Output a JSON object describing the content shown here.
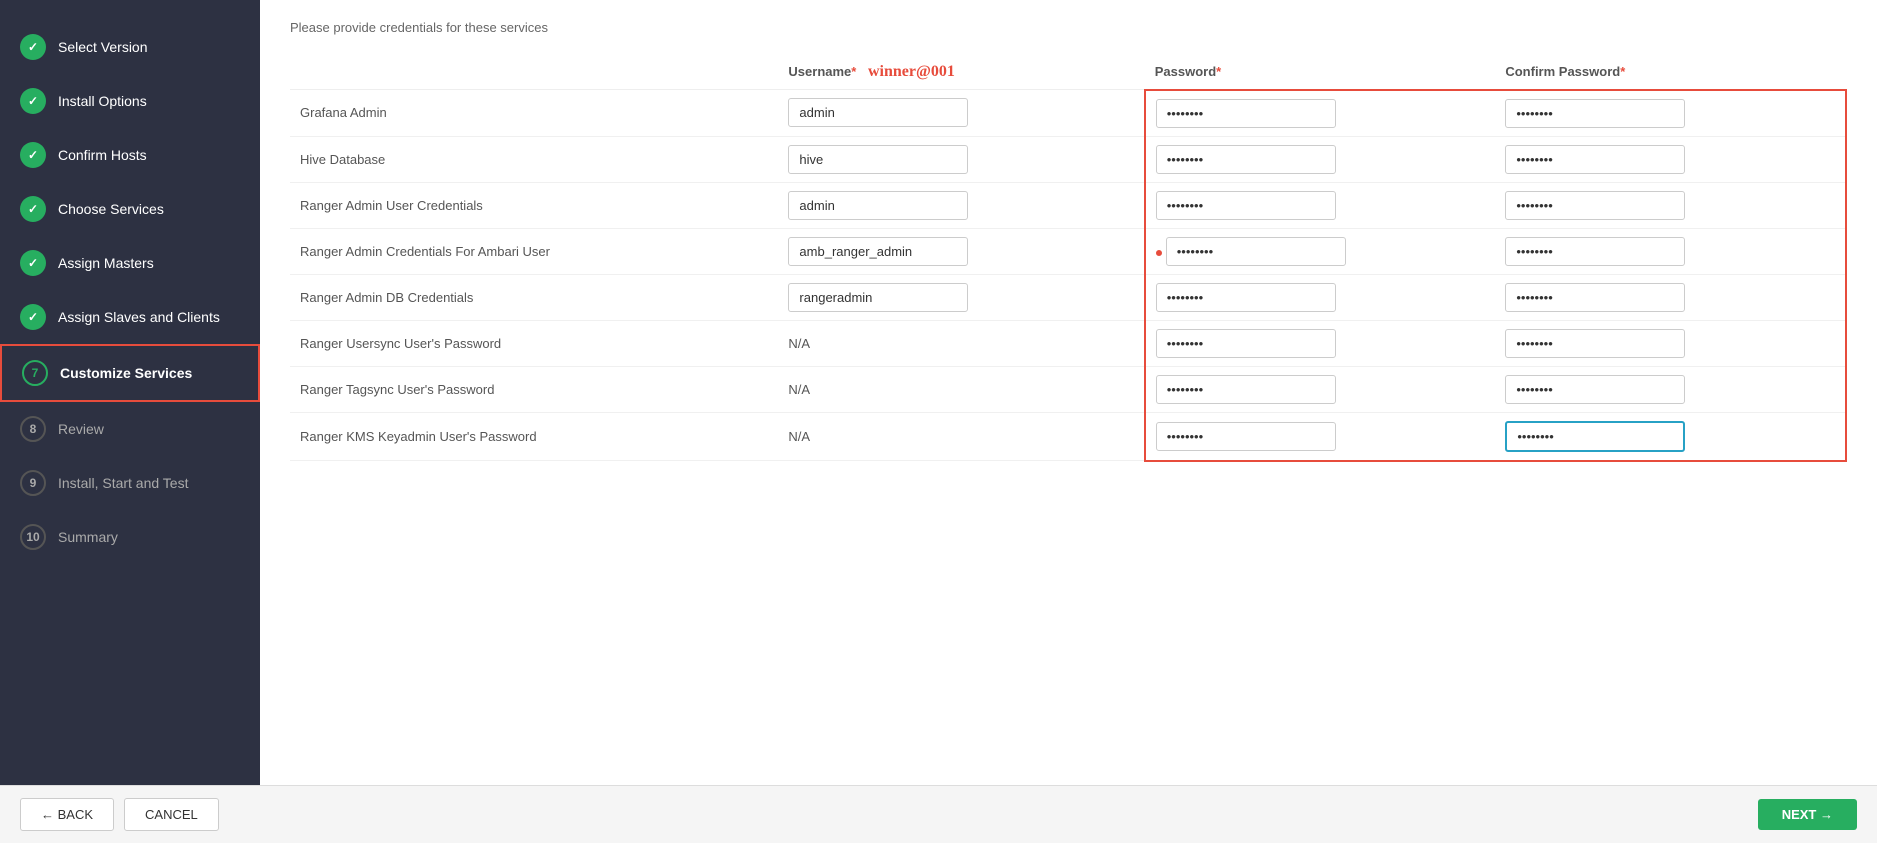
{
  "sidebar": {
    "items": [
      {
        "step": "✓",
        "label": "Select Version",
        "state": "completed"
      },
      {
        "step": "✓",
        "label": "Install Options",
        "state": "completed"
      },
      {
        "step": "✓",
        "label": "Confirm Hosts",
        "state": "completed"
      },
      {
        "step": "✓",
        "label": "Choose Services",
        "state": "completed"
      },
      {
        "step": "✓",
        "label": "Assign Masters",
        "state": "completed"
      },
      {
        "step": "✓",
        "label": "Assign Slaves and Clients",
        "state": "completed"
      },
      {
        "step": "7",
        "label": "Customize Services",
        "state": "active"
      },
      {
        "step": "8",
        "label": "Review",
        "state": "inactive"
      },
      {
        "step": "9",
        "label": "Install, Start and Test",
        "state": "inactive"
      },
      {
        "step": "10",
        "label": "Summary",
        "state": "inactive"
      }
    ]
  },
  "header": {
    "subtitle": "Please provide credentials for these services"
  },
  "columns": {
    "label": "",
    "username": "Username",
    "password": "Password",
    "confirm_password": "Confirm Password",
    "winner_label": "winner@001"
  },
  "rows": [
    {
      "service": "Grafana Admin",
      "username": "admin",
      "password": "••••••••••",
      "confirm_password": "••••••••••",
      "has_red_dot": false
    },
    {
      "service": "Hive Database",
      "username": "hive",
      "password": "••••••••••",
      "confirm_password": "••••••••••",
      "has_red_dot": false
    },
    {
      "service": "Ranger Admin User Credentials",
      "username": "admin",
      "password": "••••••••••",
      "confirm_password": "••••••••••",
      "has_red_dot": false
    },
    {
      "service": "Ranger Admin Credentials For Ambari User",
      "username": "amb_ranger_admin",
      "password": "••••••••••",
      "confirm_password": "••••••••••",
      "has_red_dot": true
    },
    {
      "service": "Ranger Admin DB Credentials",
      "username": "rangeradmin",
      "password": "••••••••••",
      "confirm_password": "••••••••••",
      "has_red_dot": false
    },
    {
      "service": "Ranger Usersync User's Password",
      "username": "N/A",
      "password": "••••••••••",
      "confirm_password": "••••••••••",
      "has_red_dot": false
    },
    {
      "service": "Ranger Tagsync User's Password",
      "username": "N/A",
      "password": "••••••••••",
      "confirm_password": "••••••••••",
      "has_red_dot": false
    },
    {
      "service": "Ranger KMS Keyadmin User's Password",
      "username": "N/A",
      "password": "••••••••••",
      "confirm_password": "•••••••••",
      "has_red_dot": false,
      "last_focused": true
    }
  ],
  "footer": {
    "back_label": "← BACK",
    "cancel_label": "CANCEL",
    "next_label": "NEXT →"
  }
}
